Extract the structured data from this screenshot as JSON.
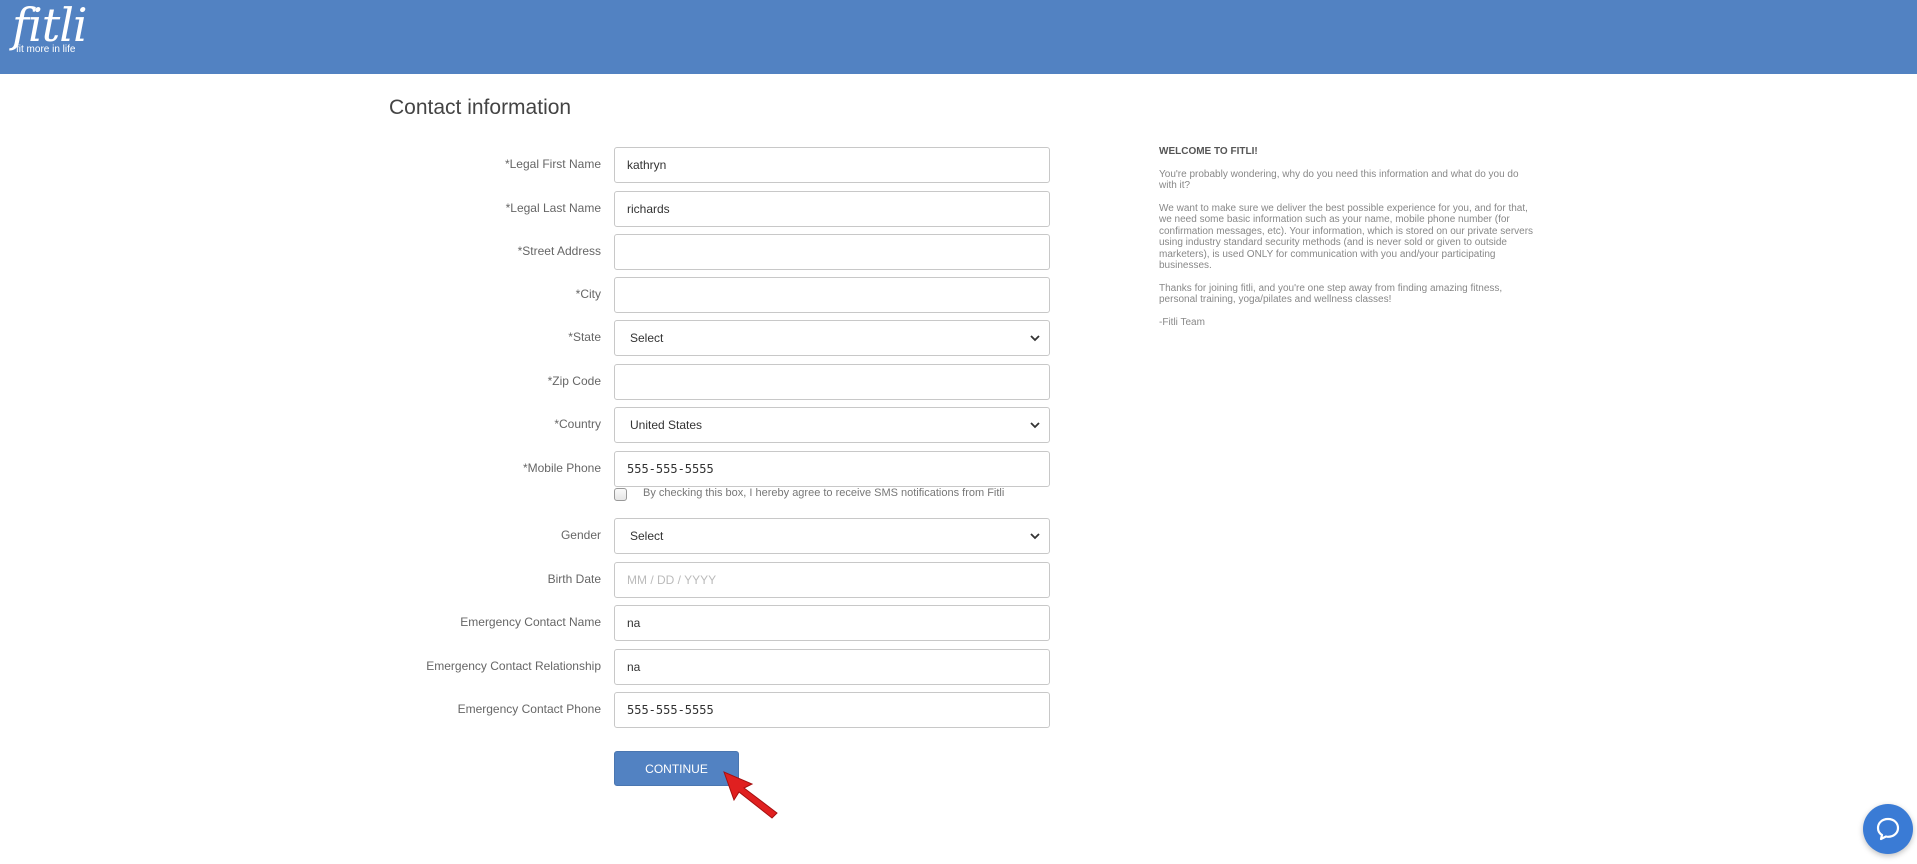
{
  "header": {
    "logo_text": "fitli",
    "logo_tagline": "fit more in life",
    "color": "#5282c2"
  },
  "page": {
    "title": "Contact information"
  },
  "form": {
    "first_name": {
      "label": "*Legal First Name",
      "value": "kathryn"
    },
    "last_name": {
      "label": "*Legal Last Name",
      "value": "richards"
    },
    "street": {
      "label": "*Street Address",
      "value": ""
    },
    "city": {
      "label": "*City",
      "value": ""
    },
    "state": {
      "label": "*State",
      "value": "Select"
    },
    "zip": {
      "label": "*Zip Code",
      "value": ""
    },
    "country": {
      "label": "*Country",
      "value": "United States"
    },
    "mobile": {
      "label": "*Mobile Phone",
      "value": "555-555-5555"
    },
    "sms_consent": {
      "label": "By checking this box, I hereby agree to receive SMS notifications from Fitli",
      "checked": false
    },
    "gender": {
      "label": "Gender",
      "value": "Select"
    },
    "birth_date": {
      "label": "Birth Date",
      "value": "",
      "placeholder": "MM / DD / YYYY"
    },
    "emergency_name": {
      "label": "Emergency Contact Name",
      "value": "na"
    },
    "emergency_relationship": {
      "label": "Emergency Contact Relationship",
      "value": "na"
    },
    "emergency_phone": {
      "label": "Emergency Contact Phone",
      "value": "555-555-5555"
    },
    "continue_label": "CONTINUE"
  },
  "welcome": {
    "title": "WELCOME TO FITLI!",
    "p1": "You're probably wondering, why do you need this information and what do you do with it?",
    "p2": "We want to make sure we deliver the best possible experience for you, and for that, we need some basic information such as your name, mobile phone number (for confirmation messages, etc).  Your information, which is stored on our private servers using industry standard security methods (and is never sold or given to outside marketers), is used ONLY for communication with you and/your participating businesses.",
    "p3": "Thanks for joining fitli, and you're one step away from finding amazing fitness, personal training, yoga/pilates and wellness classes!",
    "signature": "-Fitli Team"
  },
  "icons": {
    "chat": "chat-bubble-icon",
    "cursor": "pointer-arrow-icon"
  }
}
